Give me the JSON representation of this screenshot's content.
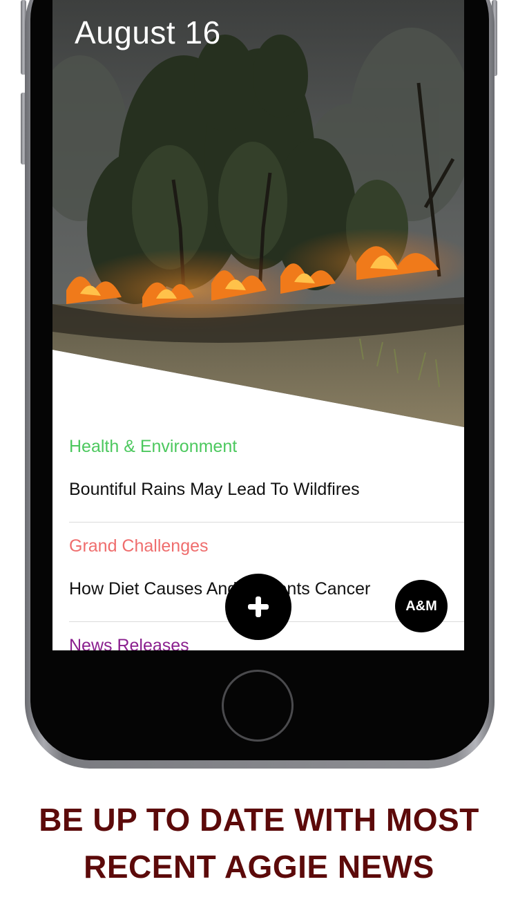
{
  "screen": {
    "date": "August 16",
    "hero_image": "wildfire-photo",
    "feed": [
      {
        "category": "Health & Environment",
        "headline": "Bountiful Rains May Lead To Wildfires",
        "color": "#4cc85e"
      },
      {
        "category": "Grand Challenges",
        "headline": "How Diet Causes And Prevents Cancer",
        "color": "#ef6d6d"
      },
      {
        "category": "News Releases",
        "headline": "",
        "color": "#8a1f8e"
      }
    ],
    "add_button_icon": "plus-icon",
    "am_button_label": "A&M"
  },
  "caption": {
    "line1": "BE UP TO DATE WITH MOST",
    "line2": "RECENT AGGIE NEWS",
    "color": "#5c0a0a"
  }
}
